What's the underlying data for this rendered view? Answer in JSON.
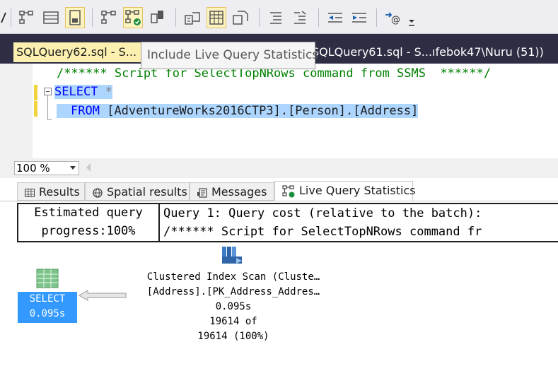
{
  "toolbar": {
    "buttons": [
      {
        "name": "include-actual-plan-icon"
      },
      {
        "name": "results-to-grid-icon"
      },
      {
        "name": "results-to-file-icon"
      },
      {
        "name": "query-options-icon"
      },
      {
        "name": "live-query-statistics-icon",
        "active": true
      },
      {
        "name": "client-statistics-icon"
      },
      {
        "name": "results-to-text-icon"
      },
      {
        "name": "results-to-grid-toggle-icon",
        "active": true
      },
      {
        "name": "results-to-file-toggle-icon"
      },
      {
        "name": "comment-out-icon"
      },
      {
        "name": "uncomment-icon"
      },
      {
        "name": "decrease-indent-icon"
      },
      {
        "name": "increase-indent-icon"
      },
      {
        "name": "specify-template-values-icon"
      },
      {
        "name": "toolbar-overflow-icon"
      }
    ]
  },
  "tabs": {
    "active_label": "SQLQuery62.sql - S...",
    "inactive_label": "SQLQuery61.sql - S...ıfebok47\\Nuru (51))"
  },
  "tooltip": {
    "text": "Include Live Query Statistics"
  },
  "editor": {
    "line1": "/****** Script for SelectTopNRows command from SSMS  ******/",
    "line2_keyword": "SELECT",
    "line2_rest": " *",
    "line3_keyword": "FROM",
    "line3_rest": "[AdventureWorks2016CTP3].[Person].[Address]"
  },
  "zoom": {
    "value": "100 %"
  },
  "result_tabs": [
    {
      "label": "Results"
    },
    {
      "label": "Spatial results"
    },
    {
      "label": "Messages"
    },
    {
      "label": "Live Query Statistics"
    }
  ],
  "progress": {
    "line1": "Estimated query",
    "line2": "progress:100%"
  },
  "query_info": {
    "line1": "Query 1: Query cost (relative to the batch):",
    "line2": "/****** Script for SelectTopNRows command fr"
  },
  "plan": {
    "select_node": {
      "label": "SELECT",
      "time": "0.095s"
    },
    "scan_node": {
      "line1": "Clustered Index Scan (Cluste…",
      "line2": "[Address].[PK_Address_Addres…",
      "time": "0.095s",
      "rows_line1": "19614 of",
      "rows_line2": "19614 (100%)"
    }
  },
  "colors": {
    "accent_yellow": "#fbf0b0",
    "tab_bar": "#2d2d44",
    "keyword_blue": "#0000ff",
    "comment_green": "#008000",
    "selection": "#add6ff",
    "select_node_bg": "#3399ff"
  }
}
